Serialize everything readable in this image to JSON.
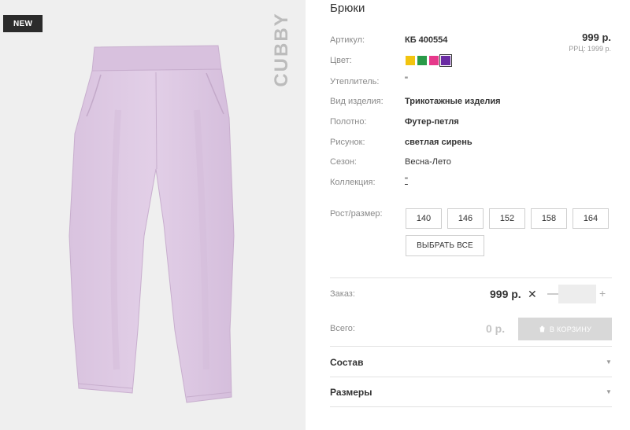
{
  "product": {
    "title": "Брюки",
    "badge": "NEW",
    "brand": "CUBBY",
    "price": "999 р.",
    "rrp": "РРЦ: 1999 р."
  },
  "details": {
    "article_label": "Артикул:",
    "article_value": "КБ 400554",
    "color_label": "Цвет:",
    "insulation_label": "Утеплитель:",
    "insulation_value": "\"",
    "type_label": "Вид изделия:",
    "type_value": "Трикотажные изделия",
    "fabric_label": "Полотно:",
    "fabric_value": "Футер-петля",
    "pattern_label": "Рисунок:",
    "pattern_value": "светлая сирень",
    "season_label": "Сезон:",
    "season_value": "Весна-Лето",
    "collection_label": "Коллекция:",
    "collection_value": "\""
  },
  "colors": [
    "#f2c40f",
    "#2a9a48",
    "#e6398b",
    "#6a2ba3"
  ],
  "sizes": {
    "label": "Рост/размер:",
    "options": [
      "140",
      "146",
      "152",
      "158",
      "164"
    ],
    "select_all": "ВЫБРАТЬ ВСЕ"
  },
  "order": {
    "label": "Заказ:",
    "price": "999 р.",
    "times": "✕",
    "minus": "—",
    "plus": "+",
    "quantity": ""
  },
  "total": {
    "label": "Всего:",
    "value": "0 р.",
    "cart_button": "В КОРЗИНУ"
  },
  "accordion": {
    "composition": "Состав",
    "sizes": "Размеры"
  }
}
